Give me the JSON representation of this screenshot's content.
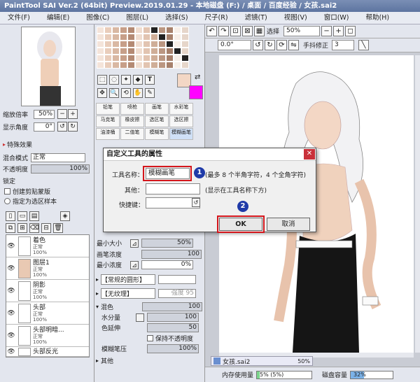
{
  "window": {
    "title": "PaintTool SAI Ver.2 (64bit) Preview.2019.01.29 - 本地磁盘 (F:) / 桌面 / 百度经验 / 女孩.sai2"
  },
  "menu": [
    "文件(F)",
    "编辑(E)",
    "图像(C)",
    "图层(L)",
    "选择(S)",
    "尺子(R)",
    "滤镜(T)",
    "视图(V)",
    "窗口(W)",
    "帮助(H)"
  ],
  "navigator": {
    "zoom_label": "缩放倍率",
    "zoom_value": "50%",
    "angle_label": "显示角度",
    "angle_value": "0°"
  },
  "layer_props": {
    "special_effects": "特殊效果",
    "blend_mode_label": "混合模式",
    "blend_mode_value": "正常",
    "opacity_label": "不透明度",
    "opacity_value": "100%",
    "lock_label": "锁定",
    "clip_mask_label": "创建剪贴蒙版",
    "selection_source_label": "指定为选区样本"
  },
  "layers": [
    {
      "name": "着色",
      "mode": "正常",
      "opacity": "100%"
    },
    {
      "name": "图层1",
      "mode": "正常",
      "opacity": "100%"
    },
    {
      "name": "阴影",
      "mode": "正常",
      "opacity": "100%"
    },
    {
      "name": "头部",
      "mode": "正常",
      "opacity": "100%"
    },
    {
      "name": "头部明暗...",
      "mode": "正常",
      "opacity": "100%"
    },
    {
      "name": "头部反光",
      "mode": "",
      "opacity": ""
    }
  ],
  "tools": [
    "铅笔",
    "喷枪",
    "画笔",
    "水彩笔",
    "马克笔",
    "橡皮擦",
    "选区笔",
    "选区擦",
    "油漆桶",
    "二值笔",
    "模糊笔",
    "模糊画笔"
  ],
  "brush_settings": {
    "min_size_label": "最小大小",
    "min_size_value": "50%",
    "density_label": "画笔浓度",
    "density_value": "100",
    "min_density_label": "最小浓度",
    "min_density_value": "0%",
    "shape_label": "【常规的圆形】",
    "texture_label": "【无纹理】",
    "texture_strength": "强度 95",
    "mix_label": "混色",
    "mix_value": "100",
    "water_label": "水分量",
    "water_value": "100",
    "extend_label": "色延伸",
    "extend_value": "50",
    "keep_opacity_label": "保持不透明度",
    "pressure_label": "模糊笔压",
    "pressure_value": "100%",
    "other_label": "其他"
  },
  "canvas_toolbar": {
    "select_label": "选择",
    "zoom_value": "50%",
    "angle_value": "0.0°",
    "stabilizer_label": "手抖修正",
    "stabilizer_value": "3"
  },
  "status": {
    "doc_name": "女孩.sai2",
    "doc_zoom": "50%",
    "memory_label": "内存使用量",
    "memory_value": "5% (5%)",
    "disk_label": "磁盘容量",
    "disk_value": "32%"
  },
  "dialog": {
    "title": "自定义工具的属性",
    "name_label": "工具名称：",
    "name_value": "模糊画笔",
    "name_hint": "(最多 8 个半角字符，4 个全角字符)",
    "other_label": "其他：",
    "other_hint": "(显示在工具名称下方)",
    "shortcut_label": "快捷键：",
    "ok_label": "OK",
    "cancel_label": "取消"
  },
  "markers": [
    "1",
    "2"
  ],
  "colors": {
    "primary": "#f3d7c5",
    "secondary": "#ff00ff",
    "highlight": "#d4161c",
    "marker": "#1f3aa8"
  }
}
